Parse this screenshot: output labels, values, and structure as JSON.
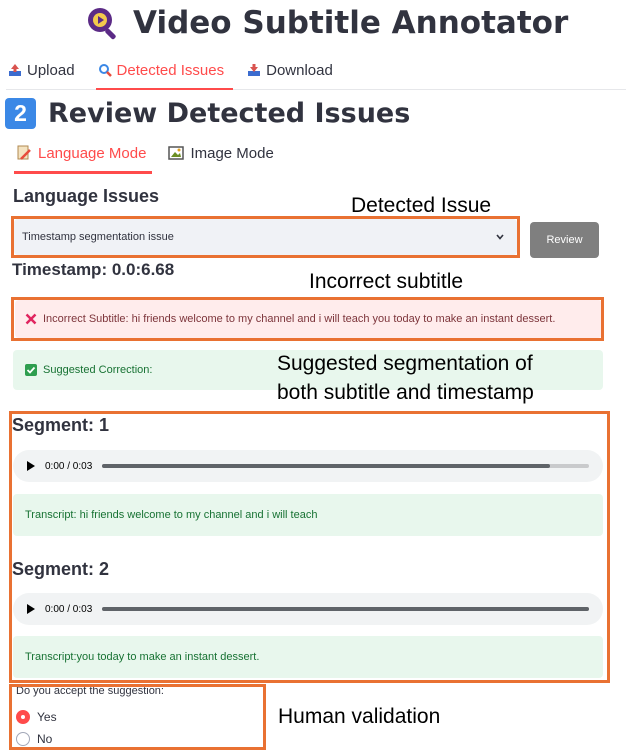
{
  "app": {
    "title": "Video Subtitle Annotator"
  },
  "top_tabs": [
    {
      "label": "Upload",
      "active": false
    },
    {
      "label": "Detected Issues",
      "active": true
    },
    {
      "label": "Download",
      "active": false
    }
  ],
  "section": {
    "number": "2",
    "title": "Review Detected Issues"
  },
  "mode_tabs": [
    {
      "label": "Language Mode",
      "active": true
    },
    {
      "label": "Image Mode",
      "active": false
    }
  ],
  "language_issues": {
    "label": "Language Issues",
    "selected_issue": "Timestamp segmentation issue",
    "review_label": "Review"
  },
  "timestamp": "Timestamp: 0.0:6.68",
  "incorrect": {
    "text": "Incorrect Subtitle: hi friends welcome to my channel and i will teach you today to make an instant dessert."
  },
  "suggested": {
    "text": "Suggested Correction:"
  },
  "segments": [
    {
      "title": "Segment: 1",
      "time": "0:00 / 0:03",
      "progress": 0.92,
      "transcript": "Transcript: hi friends welcome to my channel and i will teach"
    },
    {
      "title": "Segment: 2",
      "time": "0:00 / 0:03",
      "progress": 1.0,
      "transcript": "Transcript:you today to make an instant dessert."
    }
  ],
  "validation": {
    "question": "Do you accept the suggestion:",
    "options": [
      {
        "label": "Yes",
        "selected": true
      },
      {
        "label": "No",
        "selected": false
      }
    ]
  },
  "annotations": {
    "detected_issue": "Detected Issue",
    "incorrect_subtitle": "Incorrect subtitle",
    "suggested_line1": "Suggested segmentation of",
    "suggested_line2": "both subtitle and timestamp",
    "human_validation": "Human validation"
  },
  "colors": {
    "accent": "#ff4b4b",
    "annotation": "#e97132",
    "success_bg": "#e8f7ed",
    "error_bg": "#ffecec",
    "badge": "#3b88e6"
  },
  "icons": {
    "logo": "magnifier-video-icon",
    "upload": "upload-icon",
    "detected": "search-icon",
    "download": "download-icon",
    "language": "pencil-icon",
    "image": "image-frame-icon",
    "error": "cross-icon",
    "success": "check-icon"
  }
}
